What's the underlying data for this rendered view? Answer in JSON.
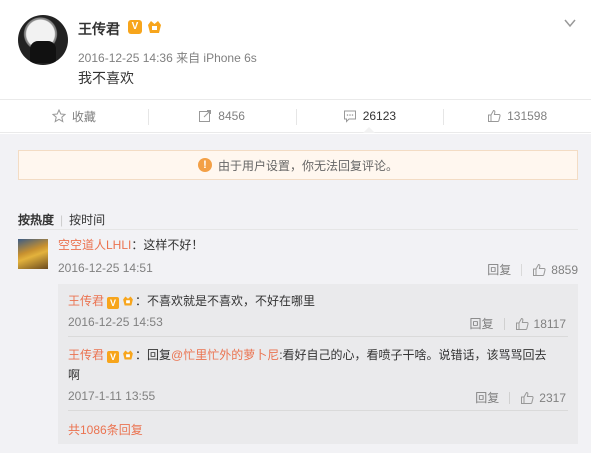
{
  "post": {
    "author": "王传君",
    "verified_badge": "V",
    "meta": "2016-12-25 14:36 来自 iPhone 6s",
    "content": "我不喜欢"
  },
  "actions": {
    "favorite": "收藏",
    "repost": "8456",
    "comment": "26123",
    "like": "131598"
  },
  "notice": "由于用户设置，你无法回复评论。",
  "sort": {
    "hot": "按热度",
    "time": "按时间"
  },
  "comment": {
    "user": "空空道人LHLI",
    "text": "：这样不好！",
    "time": "2016-12-25 14:51",
    "reply_label": "回复",
    "likes": "8859"
  },
  "replies": [
    {
      "user": "王传君",
      "badge": "V",
      "text": "：不喜欢就是不喜欢，不好在哪里",
      "time": "2016-12-25 14:53",
      "reply_label": "回复",
      "likes": "18117"
    },
    {
      "user": "王传君",
      "badge": "V",
      "text_prefix": "：回复",
      "mention": "@忙里忙外的萝卜尼",
      "text": ":看好自己的心，看喷子干啥。说错话，该骂骂回去",
      "text_cont": "啊",
      "time": "2017-1-11 13:55",
      "reply_label": "回复",
      "likes": "2317"
    }
  ],
  "more_replies": "共1086条回复",
  "colors": {
    "accent": "#eb7350",
    "badge": "#f7a51c",
    "notice_bg": "#fff7ef"
  },
  "icons": [
    "star-icon",
    "repost-icon",
    "comment-icon",
    "thumbs-up-icon",
    "warning-icon",
    "chevron-down-icon",
    "vip-icon"
  ]
}
